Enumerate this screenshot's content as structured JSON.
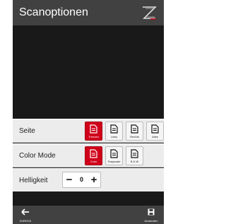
{
  "header": {
    "title": "Scanoptionen",
    "logo_icon": "brand-logo-icon"
  },
  "rows": {
    "side": {
      "label": "Seite",
      "options": [
        {
          "label": "Trennen",
          "icon": "document-icon",
          "selected": true
        },
        {
          "label": "Links",
          "icon": "document-icon",
          "selected": false
        },
        {
          "label": "Rechts",
          "icon": "document-icon",
          "selected": false
        },
        {
          "label": "Alles",
          "icon": "document-icon",
          "selected": false
        }
      ]
    },
    "color_mode": {
      "label": "Color Mode",
      "options": [
        {
          "label": "Color",
          "icon": "document-icon",
          "selected": true
        },
        {
          "label": "Grayscale",
          "icon": "document-icon",
          "selected": false
        },
        {
          "label": "B & W",
          "icon": "document-icon",
          "selected": false
        }
      ]
    },
    "brightness": {
      "label": "Helligkeit",
      "minus": "−",
      "value": "0",
      "plus": "+"
    }
  },
  "bottom_bar": {
    "back": {
      "label": "ZURÜCK",
      "icon": "arrow-left-icon"
    },
    "apply": {
      "label": "Anwenden",
      "icon": "save-icon"
    }
  },
  "colors": {
    "accent": "#d0021b",
    "header_bg": "#414141",
    "row_bg": "#ececec",
    "dark_bg": "#191919"
  }
}
